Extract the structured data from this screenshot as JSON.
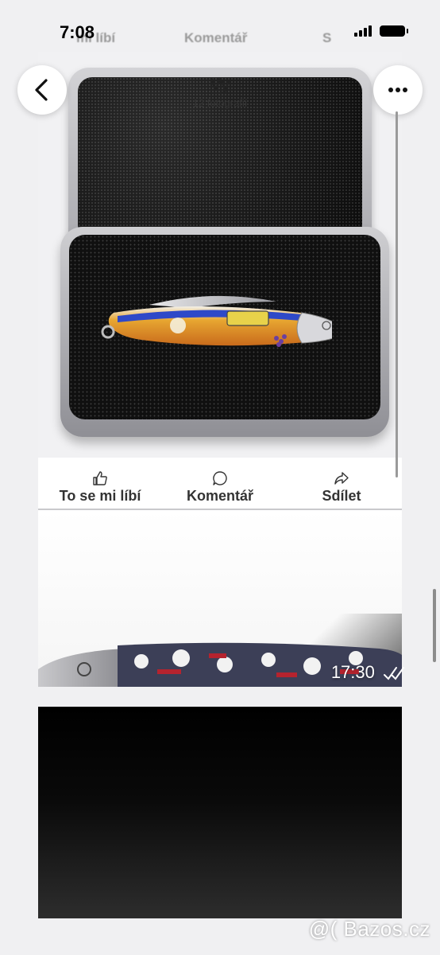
{
  "status_bar": {
    "time": "7:08"
  },
  "ghost_actions": {
    "like": "mi líbí",
    "comment": "Komentář",
    "share": "S"
  },
  "header": {
    "title": "Vy",
    "subtitle": "12 fotografií"
  },
  "post_actions": {
    "like": "To se mi líbí",
    "comment": "Komentář",
    "share": "Sdílet"
  },
  "photo2": {
    "time": "17:30"
  },
  "watermark": "@( Bazos.cz",
  "icons": {
    "back": "chevron-left-icon",
    "more": "ellipsis-icon",
    "like": "thumbs-up-icon",
    "comment": "speech-bubble-icon",
    "share": "share-arrow-icon"
  }
}
